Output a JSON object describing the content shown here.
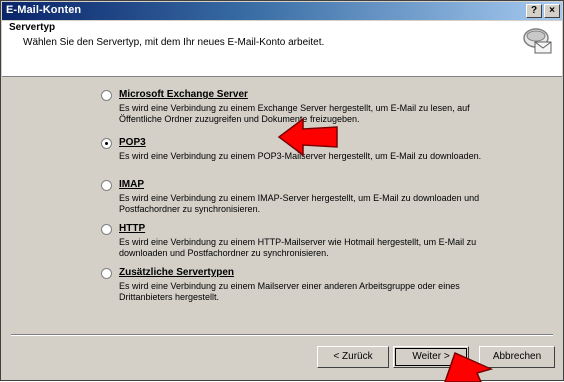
{
  "window": {
    "title": "E-Mail-Konten",
    "help_label": "?",
    "close_label": "×"
  },
  "header": {
    "title": "Servertyp",
    "subtitle": "Wählen Sie den Servertyp, mit dem Ihr neues E-Mail-Konto arbeitet."
  },
  "options": [
    {
      "label": "Microsoft Exchange Server",
      "description": "Es wird eine Verbindung zu einem Exchange Server hergestellt, um E-Mail zu lesen, auf Öffentliche Ordner zuzugreifen und Dokumente freizugeben.",
      "selected": false
    },
    {
      "label": "POP3",
      "description": "Es wird eine Verbindung zu einem POP3-Mailserver hergestellt, um E-Mail zu downloaden.",
      "selected": true
    },
    {
      "label": "IMAP",
      "description": "Es wird eine Verbindung zu einem IMAP-Server hergestellt, um E-Mail zu downloaden und Postfachordner zu synchronisieren.",
      "selected": false
    },
    {
      "label": "HTTP",
      "description": "Es wird eine Verbindung zu einem HTTP-Mailserver wie Hotmail hergestellt, um E-Mail zu downloaden und Postfachordner zu synchronisieren.",
      "selected": false
    },
    {
      "label": "Zusätzliche Servertypen",
      "description": "Es wird eine Verbindung zu einem Mailserver einer anderen Arbeitsgruppe oder eines Drittanbieters hergestellt.",
      "selected": false
    }
  ],
  "buttons": {
    "back": "< Zurück",
    "next": "Weiter >",
    "cancel": "Abbrechen"
  },
  "annotation": {
    "arrow_color": "#ff0000"
  }
}
